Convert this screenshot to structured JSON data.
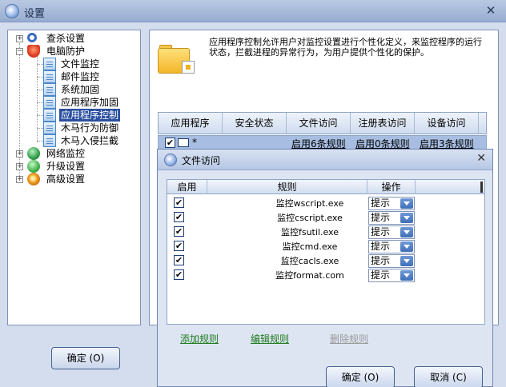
{
  "window": {
    "title": "设置"
  },
  "tree": {
    "items": [
      {
        "label": "查杀设置",
        "icon": "search-icon"
      },
      {
        "label": "电脑防护",
        "icon": "shield-icon"
      },
      {
        "label": "文件监控",
        "icon": "document-icon"
      },
      {
        "label": "邮件监控",
        "icon": "document-icon"
      },
      {
        "label": "系统加固",
        "icon": "document-icon"
      },
      {
        "label": "应用程序加固",
        "icon": "document-icon"
      },
      {
        "label": "应用程序控制",
        "icon": "document-icon",
        "selected": true
      },
      {
        "label": "木马行为防御",
        "icon": "document-icon"
      },
      {
        "label": "木马入侵拦截",
        "icon": "document-icon"
      },
      {
        "label": "网络监控",
        "icon": "network-icon"
      },
      {
        "label": "升级设置",
        "icon": "update-icon"
      },
      {
        "label": "高级设置",
        "icon": "gear-icon"
      }
    ]
  },
  "panel": {
    "description": "应用程序控制允许用户对监控设置进行个性化定义，来监控程序的运行状态，拦截进程的异常行为，为用户提供个性化的保护。",
    "columns": [
      "应用程序",
      "安全状态",
      "文件访问",
      "注册表访问",
      "设备访问"
    ],
    "row": {
      "checked": true,
      "app": "*",
      "file_access": "启用6条规则",
      "registry_access": "启用0条规则",
      "device_access": "启用3条规则"
    }
  },
  "main_ok": "确定 (O)",
  "dialog": {
    "title": "文件访问",
    "columns": [
      "启用",
      "规则",
      "操作"
    ],
    "rules": [
      {
        "enabled": true,
        "rule": "监控wscript.exe",
        "action": "提示"
      },
      {
        "enabled": true,
        "rule": "监控cscript.exe",
        "action": "提示"
      },
      {
        "enabled": true,
        "rule": "监控fsutil.exe",
        "action": "提示"
      },
      {
        "enabled": true,
        "rule": "监控cmd.exe",
        "action": "提示"
      },
      {
        "enabled": true,
        "rule": "监控cacls.exe",
        "action": "提示"
      },
      {
        "enabled": true,
        "rule": "监控format.com",
        "action": "提示"
      }
    ],
    "add_rule": "添加规则",
    "edit_rule": "编辑规则",
    "delete_rule": "删除规则",
    "ok": "确定 (O)",
    "cancel": "取消 (C)"
  },
  "colors": {
    "accent": "#2a4fa0",
    "link_green": "#1e7a1e",
    "disabled": "#9a9a9a"
  }
}
